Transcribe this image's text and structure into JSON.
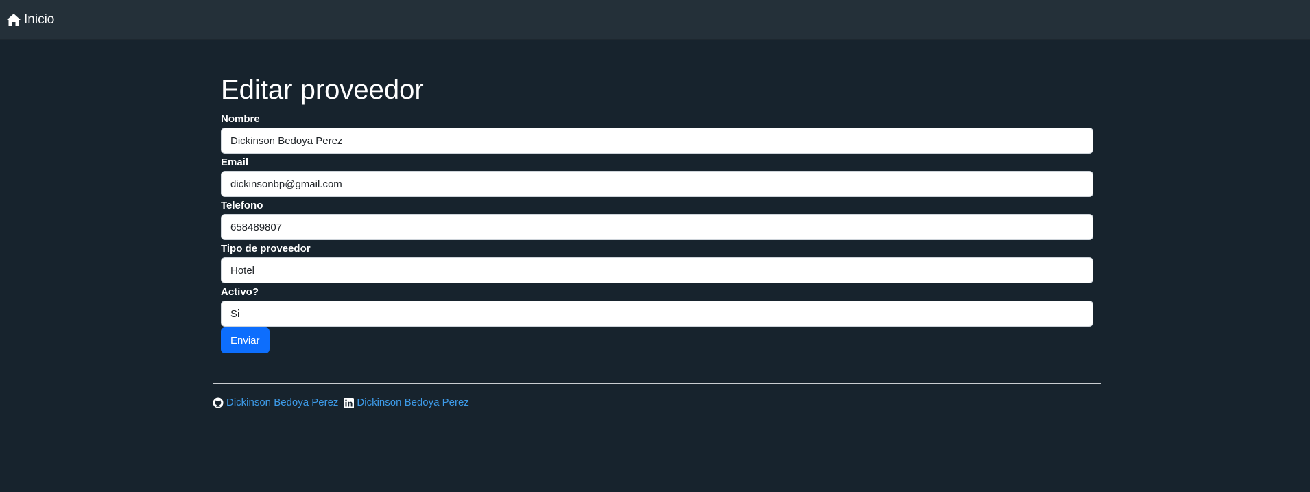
{
  "navbar": {
    "home_label": "Inicio",
    "home_icon": "house-icon"
  },
  "page": {
    "title": "Editar proveedor"
  },
  "form": {
    "nombre": {
      "label": "Nombre",
      "value": "Dickinson Bedoya Perez"
    },
    "email": {
      "label": "Email",
      "value": "dickinsonbp@gmail.com"
    },
    "telefono": {
      "label": "Telefono",
      "value": "658489807"
    },
    "tipo": {
      "label": "Tipo de proveedor",
      "value": "Hotel"
    },
    "activo": {
      "label": "Activo?",
      "value": "Si"
    },
    "submit_label": "Enviar"
  },
  "footer": {
    "github": {
      "label": "Dickinson Bedoya Perez",
      "icon": "github-icon"
    },
    "linkedin": {
      "label": "Dickinson Bedoya Perez",
      "icon": "linkedin-icon"
    }
  },
  "colors": {
    "background": "#17232d",
    "navbar": "#243039",
    "primary": "#0d6efd",
    "link": "#3d9be9"
  }
}
